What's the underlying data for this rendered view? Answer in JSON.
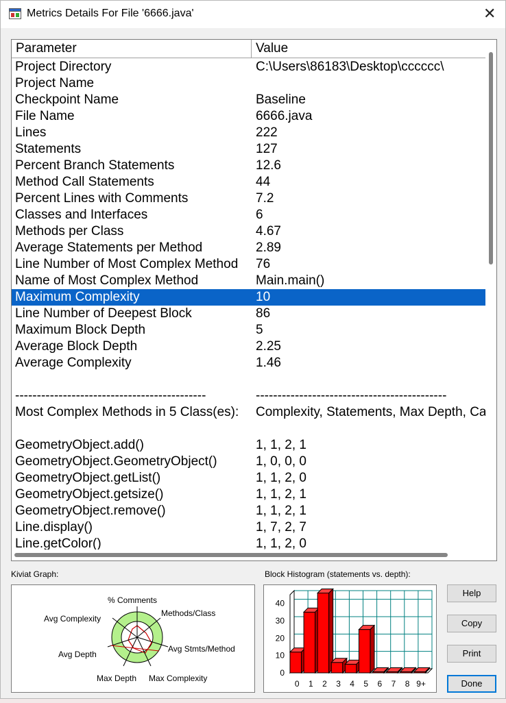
{
  "window": {
    "title": "Metrics Details For File '6666.java'"
  },
  "table": {
    "headers": [
      "Parameter",
      "Value"
    ],
    "rows": [
      [
        "Project Directory",
        "C:\\Users\\86183\\Desktop\\cccccc\\"
      ],
      [
        "Project Name",
        ""
      ],
      [
        "Checkpoint Name",
        "Baseline"
      ],
      [
        "File Name",
        "6666.java"
      ],
      [
        "Lines",
        "222"
      ],
      [
        "Statements",
        "127"
      ],
      [
        "Percent Branch Statements",
        "12.6"
      ],
      [
        "Method Call Statements",
        "44"
      ],
      [
        "Percent Lines with Comments",
        "7.2"
      ],
      [
        "Classes and Interfaces",
        "6"
      ],
      [
        "Methods per Class",
        "4.67"
      ],
      [
        "Average Statements per Method",
        "2.89"
      ],
      [
        "Line Number of Most Complex Method",
        "76"
      ],
      [
        "Name of Most Complex Method",
        "Main.main()"
      ],
      [
        "Maximum Complexity",
        "10"
      ],
      [
        "Line Number of Deepest Block",
        "86"
      ],
      [
        "Maximum Block Depth",
        "5"
      ],
      [
        "Average Block Depth",
        "2.25"
      ],
      [
        "Average Complexity",
        "1.46"
      ],
      [
        "",
        ""
      ],
      [
        "--------------------------------------------",
        "--------------------------------------------"
      ],
      [
        "Most Complex Methods in 5 Class(es):",
        "Complexity, Statements, Max Depth, Calls"
      ],
      [
        "",
        ""
      ],
      [
        "GeometryObject.add()",
        "1, 1, 2, 1"
      ],
      [
        "GeometryObject.GeometryObject()",
        "1, 0, 0, 0"
      ],
      [
        "GeometryObject.getList()",
        "1, 1, 2, 0"
      ],
      [
        "GeometryObject.getsize()",
        "1, 1, 2, 1"
      ],
      [
        "GeometryObject.remove()",
        "1, 1, 2, 1"
      ],
      [
        "Line.display()",
        "1, 7, 2, 7"
      ],
      [
        "Line.getColor()",
        "1, 1, 2, 0"
      ]
    ],
    "selected_index": 14
  },
  "kiviat": {
    "label": "Kiviat Graph:",
    "axes": [
      "% Comments",
      "Methods/Class",
      "Avg Stmts/Method",
      "Max Complexity",
      "Max Depth",
      "Avg Depth",
      "Avg Complexity"
    ]
  },
  "histogram": {
    "label": "Block Histogram (statements vs. depth):",
    "y_ticks": [
      "40",
      "30",
      "20",
      "10",
      "0"
    ],
    "x_labels": [
      "0",
      "1",
      "2",
      "3",
      "4",
      "5",
      "6",
      "7",
      "8",
      "9+"
    ],
    "values": [
      12,
      35,
      46,
      6,
      5,
      25,
      0,
      0,
      0,
      0
    ],
    "ymax": 45
  },
  "buttons": {
    "help": "Help",
    "copy": "Copy",
    "print": "Print",
    "done": "Done"
  },
  "colors": {
    "selection": "#0a64c8",
    "bar": "#ff0000",
    "kiviat_fill": "#b4f08c",
    "grid": "#008080"
  }
}
